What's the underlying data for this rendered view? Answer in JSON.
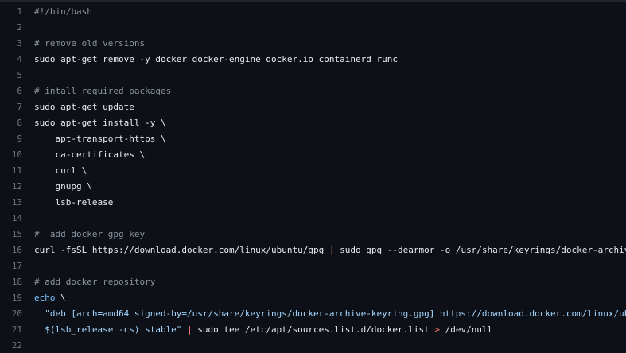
{
  "colors": {
    "background": "#0d1117",
    "line_number": "#6e7681",
    "text": "#e6edf3",
    "comment": "#8b949e",
    "builtin": "#79c0ff",
    "string": "#a5d6ff",
    "operator": "#ff7b72"
  },
  "lines": [
    {
      "n": "1",
      "tokens": [
        {
          "t": "#!/bin/bash",
          "k": "comment"
        }
      ]
    },
    {
      "n": "2",
      "tokens": []
    },
    {
      "n": "3",
      "tokens": [
        {
          "t": "# remove old versions",
          "k": "comment"
        }
      ]
    },
    {
      "n": "4",
      "tokens": [
        {
          "t": "sudo apt-get remove -y docker docker-engine docker.io containerd runc",
          "k": "plain"
        }
      ]
    },
    {
      "n": "5",
      "tokens": []
    },
    {
      "n": "6",
      "tokens": [
        {
          "t": "# intall required packages",
          "k": "comment"
        }
      ]
    },
    {
      "n": "7",
      "tokens": [
        {
          "t": "sudo apt-get update",
          "k": "plain"
        }
      ]
    },
    {
      "n": "8",
      "tokens": [
        {
          "t": "sudo apt-get install -y \\",
          "k": "plain"
        }
      ]
    },
    {
      "n": "9",
      "tokens": [
        {
          "t": "    apt-transport-https \\",
          "k": "plain"
        }
      ]
    },
    {
      "n": "10",
      "tokens": [
        {
          "t": "    ca-certificates \\",
          "k": "plain"
        }
      ]
    },
    {
      "n": "11",
      "tokens": [
        {
          "t": "    curl \\",
          "k": "plain"
        }
      ]
    },
    {
      "n": "12",
      "tokens": [
        {
          "t": "    gnupg \\",
          "k": "plain"
        }
      ]
    },
    {
      "n": "13",
      "tokens": [
        {
          "t": "    lsb-release",
          "k": "plain"
        }
      ]
    },
    {
      "n": "14",
      "tokens": []
    },
    {
      "n": "15",
      "tokens": [
        {
          "t": "#  add docker gpg key",
          "k": "comment"
        }
      ]
    },
    {
      "n": "16",
      "tokens": [
        {
          "t": "curl -fsSL https://download.docker.com/linux/ubuntu/gpg ",
          "k": "plain"
        },
        {
          "t": "|",
          "k": "op"
        },
        {
          "t": " sudo gpg --dearmor -o /usr/share/keyrings/docker-archiv",
          "k": "plain"
        }
      ]
    },
    {
      "n": "17",
      "tokens": []
    },
    {
      "n": "18",
      "tokens": [
        {
          "t": "# add docker repository",
          "k": "comment"
        }
      ]
    },
    {
      "n": "19",
      "tokens": [
        {
          "t": "echo",
          "k": "builtin"
        },
        {
          "t": " \\",
          "k": "plain"
        }
      ]
    },
    {
      "n": "20",
      "tokens": [
        {
          "t": "  \"deb [arch=amd64 signed-by=/usr/share/keyrings/docker-archive-keyring.gpg] https://download.docker.com/linux/ub",
          "k": "string"
        }
      ]
    },
    {
      "n": "21",
      "tokens": [
        {
          "t": "  $(lsb_release -cs) stable\"",
          "k": "string"
        },
        {
          "t": " ",
          "k": "plain"
        },
        {
          "t": "|",
          "k": "op"
        },
        {
          "t": " sudo tee /etc/apt/sources.list.d/docker.list ",
          "k": "plain"
        },
        {
          "t": ">",
          "k": "op"
        },
        {
          "t": " /dev/null",
          "k": "plain"
        }
      ]
    },
    {
      "n": "22",
      "tokens": []
    }
  ]
}
